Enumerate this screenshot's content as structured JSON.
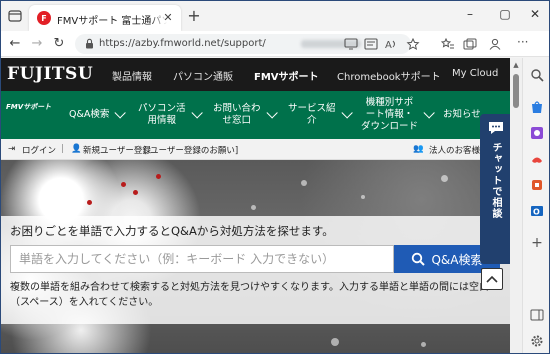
{
  "browser": {
    "tab_title": "FMVサポート 富士通パソコン 個人向",
    "tab_favicon_text": "F",
    "url_text": "https://azby.fmworld.net/support/",
    "icons": [
      "tab-actions-icon",
      "close-icon",
      "plus-icon",
      "minimize-icon",
      "maximize-icon",
      "back-icon",
      "forward-icon",
      "reload-icon",
      "lock-icon",
      "screen-icon",
      "reader-icon",
      "read-aloud-icon",
      "favorite-icon",
      "collections-icon",
      "profile-icon",
      "more-icon"
    ]
  },
  "site": {
    "logo": "FUJITSU",
    "global_nav": [
      "製品情報",
      "パソコン通販",
      "FMVサポート",
      "Chromebookサポート",
      "My Cloud"
    ],
    "sub_logo": "FMVサポート",
    "sub_nav": [
      {
        "label": "Q&A検索"
      },
      {
        "label": "パソコン活\n用情報"
      },
      {
        "label": "お問い合わ\nせ窓口"
      },
      {
        "label": "サービス紹\n介"
      },
      {
        "label": "機種別サポ\nート情報・\nダウンロード"
      },
      {
        "label": "お知らせ"
      }
    ],
    "login_bar": {
      "login": "ログイン",
      "separator": "|",
      "register": "新規ユーザー登録",
      "register_note": "[ ユーザー登録のお願い]",
      "corporate": "法人のお客様"
    },
    "search": {
      "lead": "お困りごとを単語で入力するとQ&Aから対処方法を探せます。",
      "placeholder": "単語を入力してください（例：キーボード 入力できない）",
      "button": "Q&A検索",
      "note": "複数の単語を組み合わせて検索すると対処方法を見つけやすくなります。入力する単語と単語の間には空白（スペース）を入れてください。"
    },
    "chat_label": "チャットで相談"
  },
  "colors": {
    "header_bg": "#1a1a1a",
    "subnav_bg": "#00714b",
    "search_button": "#1f5bb5",
    "chat_bg": "#21406e"
  }
}
